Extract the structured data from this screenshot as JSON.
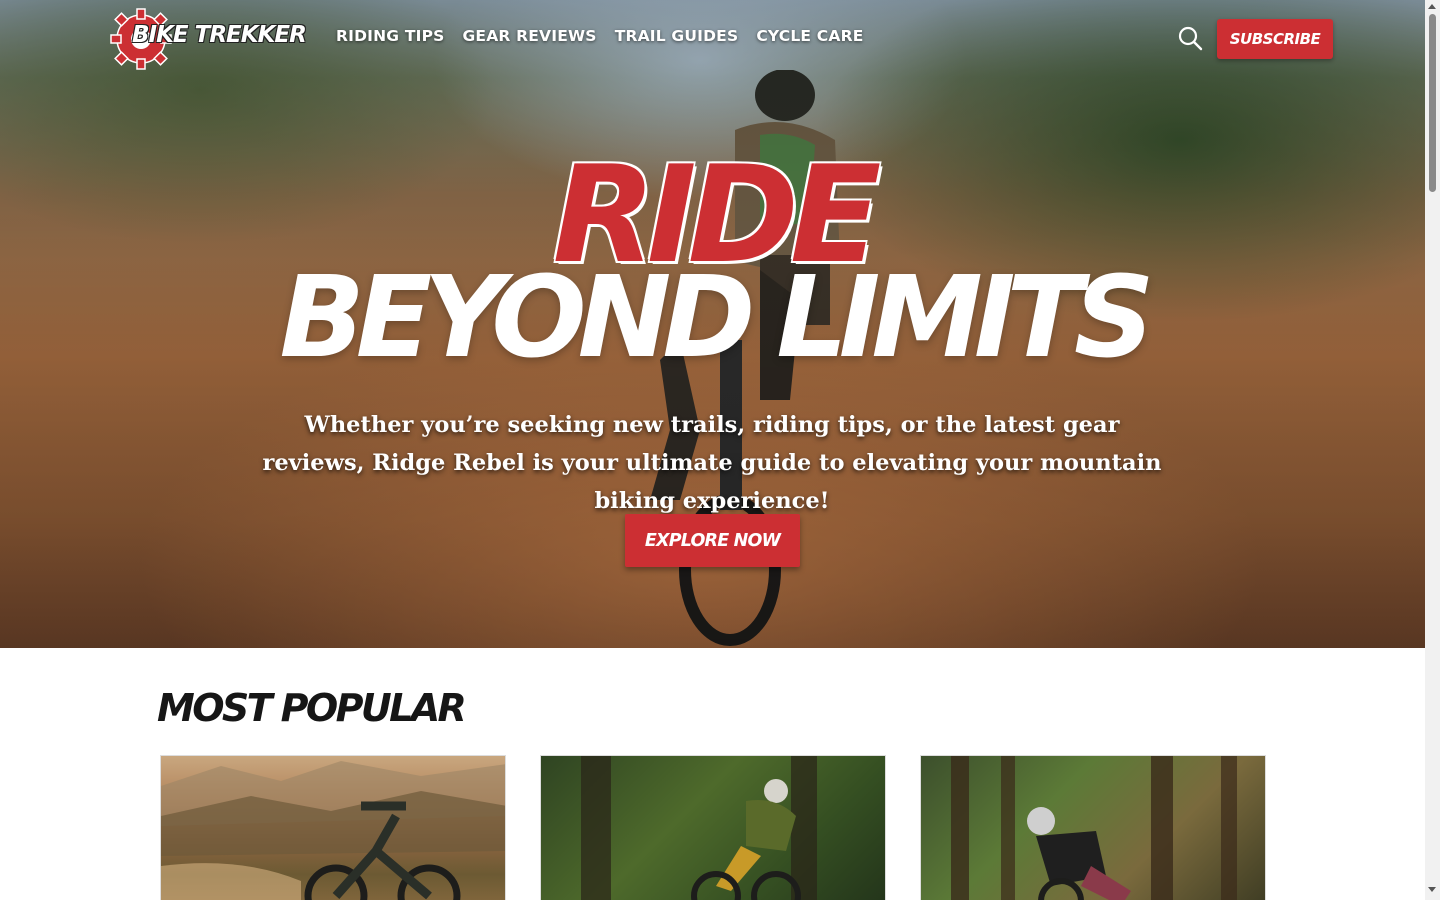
{
  "brand": {
    "name": "BIKE TREKKER",
    "accent": "#cc2f33"
  },
  "nav": {
    "items": [
      {
        "label": "RIDING TIPS"
      },
      {
        "label": "GEAR REVIEWS"
      },
      {
        "label": "TRAIL GUIDES"
      },
      {
        "label": "CYCLE CARE"
      }
    ],
    "search_icon": "search-icon",
    "subscribe_label": "SUBSCRIBE"
  },
  "hero": {
    "title_line1": "RIDE",
    "title_line2": "BEYOND LIMITS",
    "subtitle": "Whether you’re seeking new trails, riding tips, or the latest gear reviews, Ridge Rebel is your ultimate guide to elevating your mountain biking experience!",
    "cta_label": "EXPLORE NOW"
  },
  "popular": {
    "title": "MOST POPULAR"
  }
}
